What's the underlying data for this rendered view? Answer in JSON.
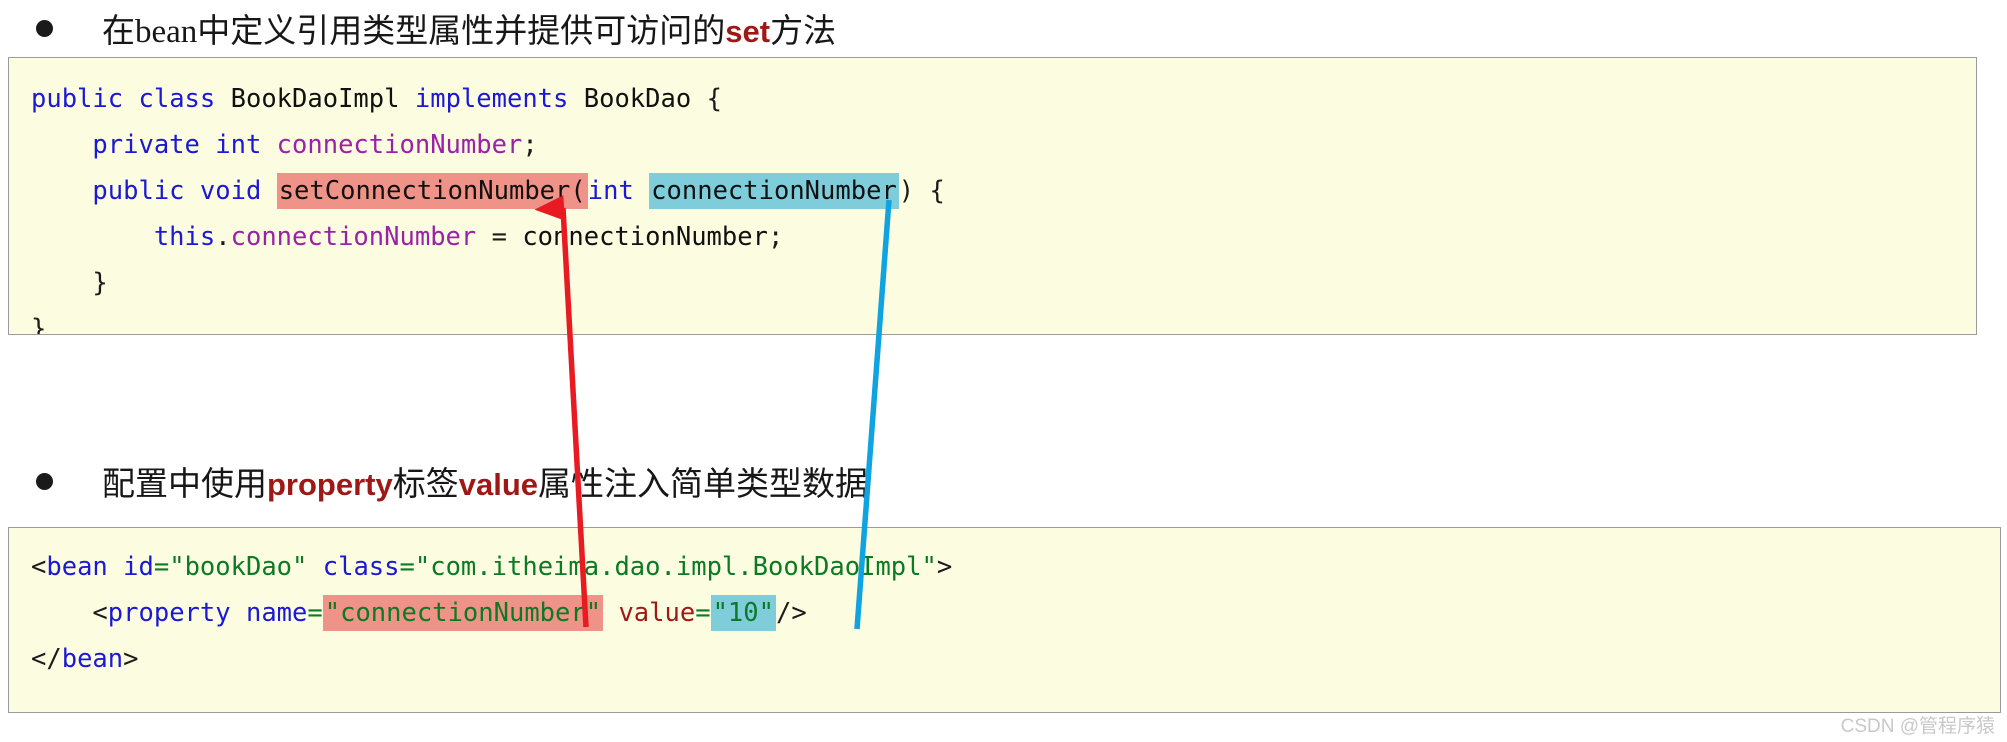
{
  "slide": {
    "background_color": "#ffffff",
    "code_background_color": "#fcfce0",
    "code_border_color": "#9b9b9b"
  },
  "bullets": [
    {
      "marker": "bullet-dot",
      "segments": [
        {
          "text": "在bean中定义引用类型属性并提供可访问的",
          "emphasis": false
        },
        {
          "text": "set",
          "emphasis": true
        },
        {
          "text": "方法",
          "emphasis": false
        }
      ],
      "plain_text": "在bean中定义引用类型属性并提供可访问的set方法"
    },
    {
      "marker": "bullet-dot",
      "segments": [
        {
          "text": "配置中使用",
          "emphasis": false
        },
        {
          "text": "property",
          "emphasis": true
        },
        {
          "text": "标签",
          "emphasis": false
        },
        {
          "text": "value",
          "emphasis": true
        },
        {
          "text": "属性注入简单类型数据",
          "emphasis": false
        }
      ],
      "plain_text": "配置中使用property标签value属性注入简单类型数据"
    }
  ],
  "code_java": {
    "language": "java",
    "lines": [
      "public class BookDaoImpl implements BookDao {",
      "    private int connectionNumber;",
      "    public void setConnectionNumber(int connectionNumber) {",
      "        this.connectionNumber = connectionNumber;",
      "    }",
      "}"
    ],
    "tokens": {
      "l1_public": "public",
      "l1_class": "class",
      "l1_name": "BookDaoImpl",
      "l1_implements": "implements",
      "l1_iface": "BookDao",
      "l1_brace": "{",
      "l2_private": "private",
      "l2_int": "int",
      "l2_field": "connectionNumber",
      "l2_semi": ";",
      "l3_public": "public",
      "l3_void": "void",
      "l3_method": "setConnectionNumber(",
      "l3_int": "int",
      "l3_param": "connectionNumber",
      "l3_tail": ") {",
      "l4_this": "this",
      "l4_dot": ".",
      "l4_field": "connectionNumber",
      "l4_eq": " = ",
      "l4_param": "connectionNumber",
      "l4_semi": ";",
      "l5_close": "}",
      "l6_close": "}"
    }
  },
  "code_xml": {
    "language": "xml",
    "lines": [
      "<bean id=\"bookDao\" class=\"com.itheima.dao.impl.BookDaoImpl\">",
      "    <property name=\"connectionNumber\" value=\"10\"/>",
      "</bean>"
    ],
    "tokens": {
      "l1_lt": "<",
      "l1_tag": "bean",
      "l1_attr_id": "id",
      "l1_eq1": "=",
      "l1_val_id": "\"bookDao\"",
      "l1_attr_class": "class",
      "l1_eq2": "=",
      "l1_val_class": "\"com.itheima.dao.impl.BookDaoImpl\"",
      "l1_gt": ">",
      "l2_lt": "<",
      "l2_tag": "property",
      "l2_attr_name": "name",
      "l2_eq1": "=",
      "l2_val_name": "\"connectionNumber\"",
      "l2_attr_value": "value",
      "l2_eq2": "=",
      "l2_val_value": "\"10\"",
      "l2_close": "/>",
      "l3_lt": "</",
      "l3_tag": "bean",
      "l3_gt": ">"
    }
  },
  "annotations": {
    "highlight_red_color": "#ef9287",
    "highlight_cyan_color": "#7fcddb",
    "arrow_red_color": "#e81b22",
    "arrow_blue_color": "#0fa3e0",
    "red_arrow_label": "property-name-maps-to-setter",
    "blue_arrow_label": "property-value-maps-to-parameter"
  },
  "watermark": {
    "text": "CSDN @管程序猿"
  }
}
